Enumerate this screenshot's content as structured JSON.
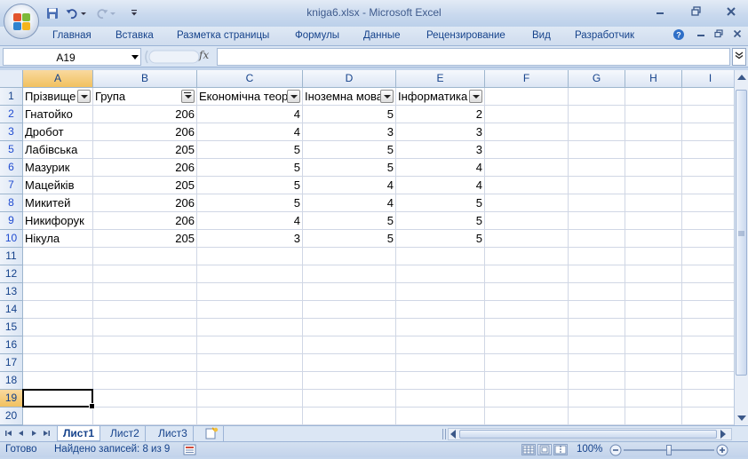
{
  "app": {
    "title": "kniga6.xlsx - Microsoft Excel"
  },
  "ribbon": {
    "tabs": [
      "Главная",
      "Вставка",
      "Разметка страницы",
      "Формулы",
      "Данные",
      "Рецензирование",
      "Вид",
      "Разработчик"
    ]
  },
  "formula_bar": {
    "name_box": "A19",
    "fx_label": "fx",
    "formula": ""
  },
  "grid": {
    "columns": [
      "A",
      "B",
      "C",
      "D",
      "E",
      "F",
      "G",
      "H",
      "I"
    ],
    "active_column": "A",
    "active_cell": "A19",
    "header_row": [
      "Прізвище",
      "Група",
      "Економічна теор",
      "Іноземна мова",
      "Інформатика"
    ],
    "filter_active_column": "B",
    "sort_column": "E",
    "rows": [
      {
        "num": "2",
        "filtered": true,
        "cells": [
          "Гнатойко",
          "206",
          "4",
          "5",
          "2"
        ]
      },
      {
        "num": "3",
        "filtered": true,
        "cells": [
          "Дробот",
          "206",
          "4",
          "3",
          "3"
        ]
      },
      {
        "num": "5",
        "filtered": true,
        "cells": [
          "Лабівська",
          "205",
          "5",
          "5",
          "3"
        ]
      },
      {
        "num": "6",
        "filtered": true,
        "cells": [
          "Мазурик",
          "206",
          "5",
          "5",
          "4"
        ]
      },
      {
        "num": "7",
        "filtered": true,
        "cells": [
          "Мацейків",
          "205",
          "5",
          "4",
          "4"
        ]
      },
      {
        "num": "8",
        "filtered": true,
        "cells": [
          "Микитей",
          "206",
          "5",
          "4",
          "5"
        ]
      },
      {
        "num": "9",
        "filtered": true,
        "cells": [
          "Никифорук",
          "206",
          "4",
          "5",
          "5"
        ]
      },
      {
        "num": "10",
        "filtered": true,
        "cells": [
          "Нікула",
          "205",
          "3",
          "5",
          "5"
        ]
      },
      {
        "num": "11",
        "filtered": false,
        "cells": [
          "",
          "",
          "",
          "",
          ""
        ]
      },
      {
        "num": "12",
        "filtered": false,
        "cells": [
          "",
          "",
          "",
          "",
          ""
        ]
      },
      {
        "num": "13",
        "filtered": false,
        "cells": [
          "",
          "",
          "",
          "",
          ""
        ]
      },
      {
        "num": "14",
        "filtered": false,
        "cells": [
          "",
          "",
          "",
          "",
          ""
        ]
      },
      {
        "num": "15",
        "filtered": false,
        "cells": [
          "",
          "",
          "",
          "",
          ""
        ]
      },
      {
        "num": "16",
        "filtered": false,
        "cells": [
          "",
          "",
          "",
          "",
          ""
        ]
      },
      {
        "num": "17",
        "filtered": false,
        "cells": [
          "",
          "",
          "",
          "",
          ""
        ]
      },
      {
        "num": "18",
        "filtered": false,
        "cells": [
          "",
          "",
          "",
          "",
          ""
        ]
      },
      {
        "num": "19",
        "filtered": false,
        "cells": [
          "",
          "",
          "",
          "",
          ""
        ]
      },
      {
        "num": "20",
        "filtered": false,
        "cells": [
          "",
          "",
          "",
          "",
          ""
        ]
      }
    ]
  },
  "sheets": {
    "tabs": [
      "Лист1",
      "Лист2",
      "Лист3"
    ],
    "active": "Лист1"
  },
  "status": {
    "ready": "Готово",
    "records": "Найдено записей: 8 из 9",
    "zoom": "100%"
  },
  "colors": {
    "frame": "#c5d6ec",
    "accent_header": "#f1c15f",
    "filtered_row_number": "#1f4bd1"
  }
}
